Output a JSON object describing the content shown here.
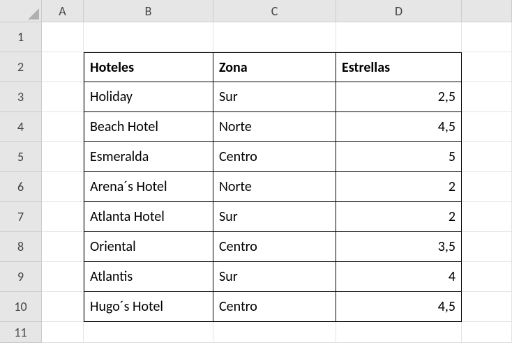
{
  "columns": [
    "A",
    "B",
    "C",
    "D"
  ],
  "rows": [
    "1",
    "2",
    "3",
    "4",
    "5",
    "6",
    "7",
    "8",
    "9",
    "10",
    "11"
  ],
  "headers": {
    "b": "Hoteles",
    "c": "Zona",
    "d": "Estrellas"
  },
  "data": [
    {
      "b": "Holiday",
      "c": "Sur",
      "d": "2,5"
    },
    {
      "b": "Beach Hotel",
      "c": "Norte",
      "d": "4,5"
    },
    {
      "b": "Esmeralda",
      "c": "Centro",
      "d": "5"
    },
    {
      "b": "Arena´s Hotel",
      "c": "Norte",
      "d": "2"
    },
    {
      "b": "Atlanta Hotel",
      "c": "Sur",
      "d": "2"
    },
    {
      "b": "Oriental",
      "c": "Centro",
      "d": "3,5"
    },
    {
      "b": "Atlantis",
      "c": "Sur",
      "d": "4"
    },
    {
      "b": "Hugo´s Hotel",
      "c": "Centro",
      "d": "4,5"
    }
  ]
}
